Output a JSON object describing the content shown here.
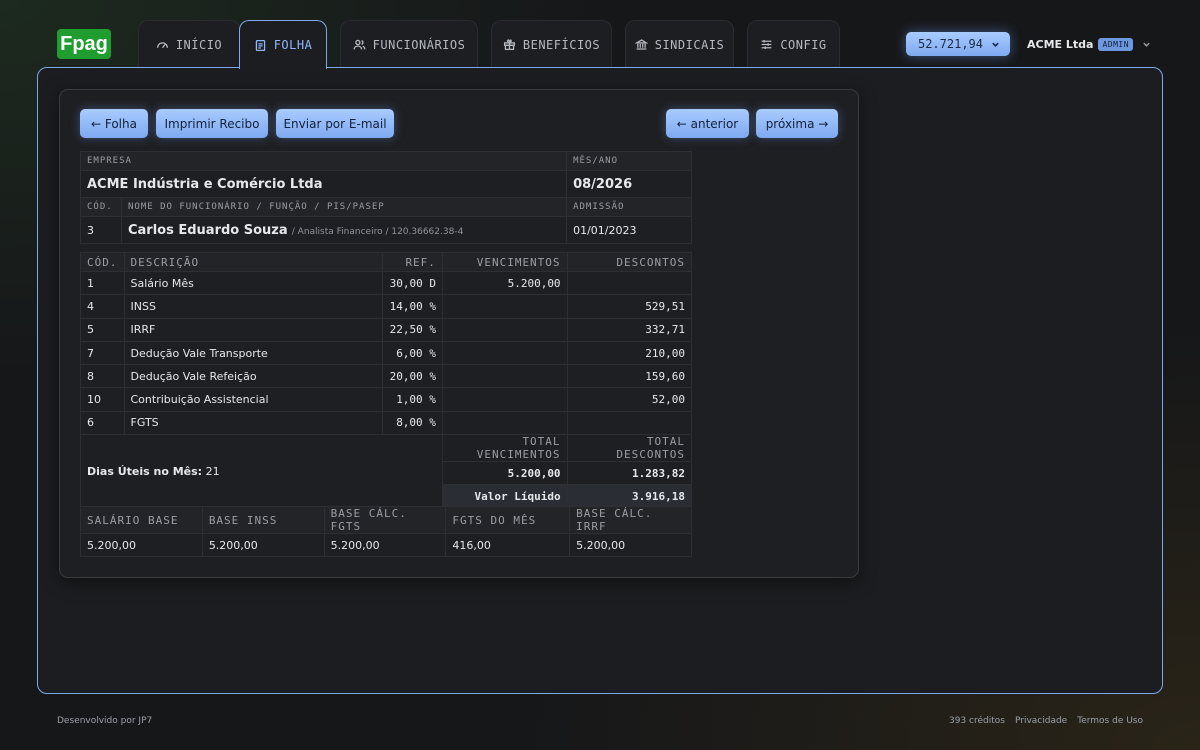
{
  "brand": {
    "logo": "Fpag",
    "accent": "#1f9d2f",
    "primary": "#7fa8e8"
  },
  "nav": {
    "tabs": [
      {
        "label": "INÍCIO",
        "icon": "gauge-icon",
        "active": false
      },
      {
        "label": "FOLHA",
        "icon": "document-icon",
        "active": true
      },
      {
        "label": "FUNCIONÁRIOS",
        "icon": "users-icon",
        "active": false
      },
      {
        "label": "BENEFÍCIOS",
        "icon": "gift-icon",
        "active": false
      },
      {
        "label": "SINDICAIS",
        "icon": "bank-icon",
        "active": false
      },
      {
        "label": "CONFIG",
        "icon": "sliders-icon",
        "active": false
      }
    ],
    "balance": "52.721,94",
    "company": "ACME Ltda",
    "role_badge": "ADMIN"
  },
  "actions": {
    "back": "← Folha",
    "print": "Imprimir Recibo",
    "email": "Enviar por E-mail",
    "previous": "← anterior",
    "next": "próxima →"
  },
  "header": {
    "empresa_label": "EMPRESA",
    "empresa": "ACME Indústria e Comércio Ltda",
    "mes_ano_label": "MÊS/ANO",
    "mes_ano": "08/2026",
    "cod_label": "CÓD.",
    "cod": "3",
    "nome_label": "NOME DO FUNCIONÁRIO / FUNÇÃO / PIS/PASEP",
    "nome": "Carlos Eduardo Souza",
    "funcao_pis": "/ Analista Financeiro / 120.36662.38-4",
    "admissao_label": "ADMISSÃO",
    "admissao": "01/01/2023"
  },
  "items": {
    "columns": {
      "cod": "CÓD.",
      "descricao": "DESCRIÇÃO",
      "ref": "REF.",
      "vencimentos": "VENCIMENTOS",
      "descontos": "DESCONTOS"
    },
    "rows": [
      {
        "cod": "1",
        "descricao": "Salário Mês",
        "ref": "30,00 D",
        "vencimentos": "5.200,00",
        "descontos": ""
      },
      {
        "cod": "4",
        "descricao": "INSS",
        "ref": "14,00 %",
        "vencimentos": "",
        "descontos": "529,51"
      },
      {
        "cod": "5",
        "descricao": "IRRF",
        "ref": "22,50 %",
        "vencimentos": "",
        "descontos": "332,71"
      },
      {
        "cod": "7",
        "descricao": "Dedução Vale Transporte",
        "ref": "6,00 %",
        "vencimentos": "",
        "descontos": "210,00"
      },
      {
        "cod": "8",
        "descricao": "Dedução Vale Refeição",
        "ref": "20,00 %",
        "vencimentos": "",
        "descontos": "159,60"
      },
      {
        "cod": "10",
        "descricao": "Contribuição Assistencial",
        "ref": "1,00 %",
        "vencimentos": "",
        "descontos": "52,00"
      },
      {
        "cod": "6",
        "descricao": "FGTS",
        "ref": "8,00 %",
        "vencimentos": "",
        "descontos": ""
      }
    ]
  },
  "totals": {
    "dias_label": "Dias Úteis no Mês:",
    "dias": "21",
    "total_venc_label": "TOTAL VENCIMENTOS",
    "total_desc_label": "TOTAL DESCONTOS",
    "total_venc": "5.200,00",
    "total_desc": "1.283,82",
    "liquido_label": "Valor Líquido",
    "liquido": "3.916,18"
  },
  "bases": {
    "columns": [
      "SALÁRIO BASE",
      "BASE INSS",
      "BASE CÁLC. FGTS",
      "FGTS DO MÊS",
      "BASE CÁLC. IRRF"
    ],
    "values": [
      "5.200,00",
      "5.200,00",
      "5.200,00",
      "416,00",
      "5.200,00"
    ]
  },
  "footer": {
    "credit": "Desenvolvido por JP7",
    "credits": "393 créditos",
    "privacy": "Privacidade",
    "terms": "Termos de Uso"
  }
}
